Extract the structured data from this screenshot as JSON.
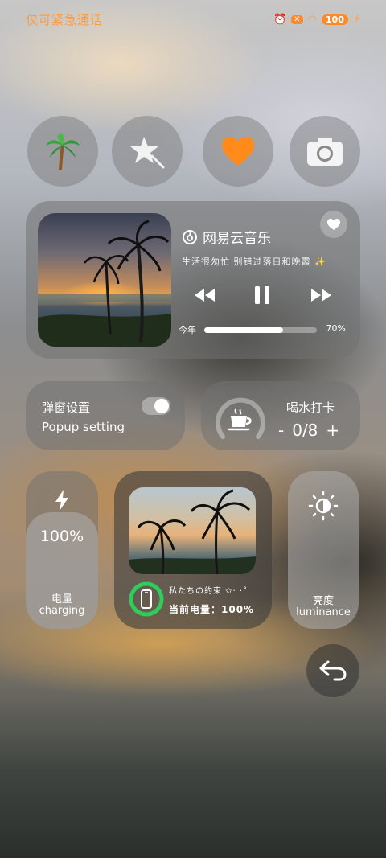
{
  "status_bar": {
    "carrier": "仅可紧急通话",
    "battery": "100"
  },
  "quick_buttons": [
    {
      "name": "palm-tree-icon"
    },
    {
      "name": "star-sparkle-icon"
    },
    {
      "name": "orange-heart-icon"
    },
    {
      "name": "camera-icon"
    }
  ],
  "music": {
    "app_name": "网易云音乐",
    "subtitle": "生活很匆忙 别错过落日和晚霞",
    "progress_label": "今年",
    "progress_percent": "70%",
    "progress_fraction": 0.7
  },
  "popup": {
    "title": "弹窗设置",
    "subtitle": "Popup setting",
    "enabled": true
  },
  "water": {
    "title": "喝水打卡",
    "minus": "-",
    "count": "0/8",
    "plus": "+"
  },
  "battery_card": {
    "percent": "100%",
    "label_cn": "电量",
    "label_en": "charging",
    "fraction": 1.0
  },
  "photo_card": {
    "line1": "私たちの約束 ✩· ·˚",
    "line2": "当前电量：100%"
  },
  "brightness": {
    "label_cn": "亮度",
    "label_en": "luminance"
  },
  "colors": {
    "accent_orange": "#ff9b3a",
    "ring_green": "#2ecc5a"
  }
}
